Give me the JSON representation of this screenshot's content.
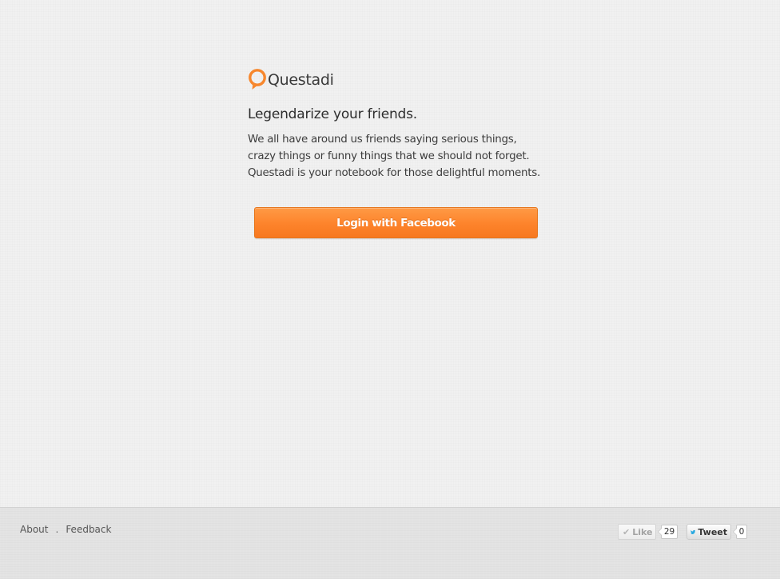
{
  "brand": {
    "name": "Questadi",
    "accent_color": "#f7872d"
  },
  "hero": {
    "tagline": "Legendarize your friends.",
    "description": "We all have around us friends saying serious things, crazy things or funny things that we should not forget. Questadi is your notebook for those delightful moments.",
    "login_button_label": "Login with Facebook"
  },
  "footer": {
    "links": [
      {
        "label": "About"
      },
      {
        "label": "Feedback"
      }
    ],
    "separator": ".",
    "social": {
      "like_label": "Like",
      "like_count": "29",
      "tweet_label": "Tweet",
      "tweet_count": "0",
      "icons": [
        "check-icon",
        "twitter-bird-icon"
      ]
    }
  }
}
